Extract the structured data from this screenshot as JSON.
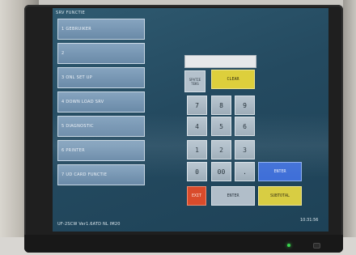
{
  "screen": {
    "title": "SRV FUNCTIE"
  },
  "menu": {
    "items": [
      {
        "label": "1 GEBRUIKER"
      },
      {
        "label": "2"
      },
      {
        "label": "3 ONL SET UP"
      },
      {
        "label": "4 DOWN LOAD SRV"
      },
      {
        "label": "5 DIAGNOSTIC"
      },
      {
        "label": "6 PRINTER"
      },
      {
        "label": "7 UD CARD FUNCTIE"
      }
    ]
  },
  "keypad": {
    "display_value": "",
    "spatie_line1": "SPATIE",
    "spatie_line2": "TEKS",
    "clear": "CLEAR",
    "keys": [
      "7",
      "8",
      "9",
      "4",
      "5",
      "6",
      "1",
      "2",
      "3",
      "0",
      "00",
      "."
    ],
    "enter_blue": "ENTER",
    "exit": "EXIT",
    "enter": "ENTER",
    "subtotal": "SUBTOTAL"
  },
  "status": {
    "left": "UF-2SCW  Ver1.6ATD NL IM20",
    "time": "10:31:56"
  }
}
